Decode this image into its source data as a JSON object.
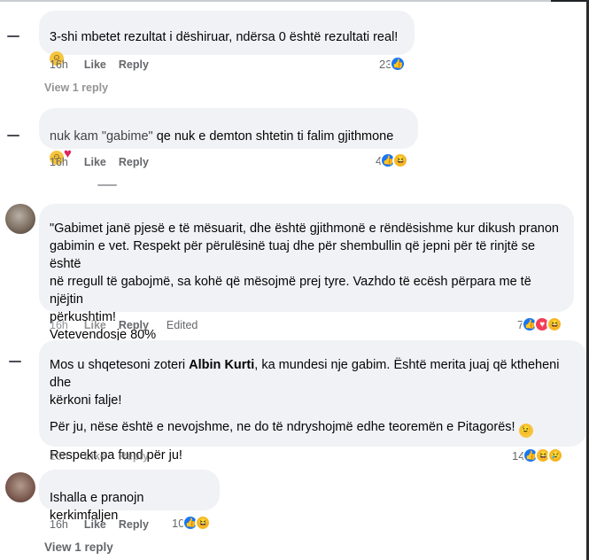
{
  "comments": [
    {
      "text": "3-shi mbetet rezultat i dëshiruar, ndërsa 0 është rezultati real!",
      "time": "16h",
      "like": "Like",
      "reply": "Reply",
      "reactions_count": "23",
      "view_replies": "View 1 reply"
    },
    {
      "text_prefix": "nuk kam \"gabime\"",
      "text": " qe nuk e demton shtetin ti falim gjithmone",
      "time": "16h",
      "like": "Like",
      "reply": "Reply",
      "reactions_count": "4"
    },
    {
      "line1": "\"Gabimet janë pjesë e të mësuarit, dhe është gjithmonë e rëndësishme kur dikush pranon",
      "line2": "gabimin e vet. Respekt për përulësinë tuaj dhe për shembullin që jepni për të rinjtë se është",
      "line3": "në rregull të gabojmë, sa kohë që mësojmë prej tyre. Vazhdo të ecësh përpara me të njëjtin",
      "line4": "përkushtim!",
      "line5": "Vetevendosje 80%",
      "time": "16h",
      "like": "Like",
      "reply": "Reply",
      "edited": "Edited",
      "reactions_count": "7"
    },
    {
      "para1_a": "Mos u shqetesoni zoteri ",
      "para1_name": "Albin Kurti",
      "para1_b": ", ka mundesi nje gabim. Është merita juaj që ktheheni dhe",
      "para1_line2": "kërkoni falje!",
      "para2": "Për ju, nëse është e nevojshme, ne do të ndryshojmë edhe teoremën e Pitagorës!",
      "para3": "Respekt pa fund për ju!",
      "time": "16h",
      "like": "Like",
      "reply": "Reply",
      "reactions_count": "14"
    },
    {
      "text": "Ishalla e pranojn kerkimfaljen",
      "time": "16h",
      "like": "Like",
      "reply": "Reply",
      "reactions_count": "10",
      "view_replies": "View 1 reply"
    }
  ],
  "colors": {
    "bubble": "#f0f2f5",
    "meta_text": "#65676b",
    "like_blue": "#1877f2",
    "haha_yellow": "#f7b928",
    "love_red": "#f33e58"
  },
  "icons": {
    "like": "thumbs-up-icon",
    "haha": "haha-icon",
    "love": "love-icon",
    "smile": "smile-emoji-icon",
    "heart": "red-heart-emoji-icon",
    "wink": "wink-emoji-icon"
  }
}
